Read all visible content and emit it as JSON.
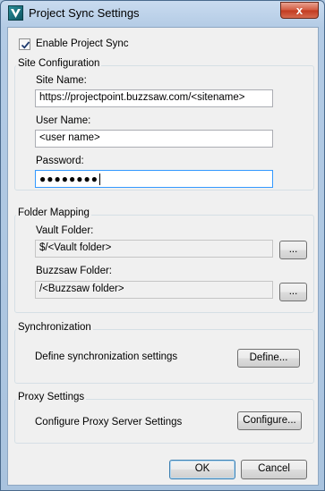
{
  "window": {
    "title": "Project Sync Settings",
    "close_glyph": "x"
  },
  "enable_sync": {
    "label": "Enable Project Sync",
    "checked": true
  },
  "site_config": {
    "title": "Site Configuration",
    "site_name_label": "Site Name:",
    "site_name_value": "https://projectpoint.buzzsaw.com/<sitename>",
    "user_name_label": "User Name:",
    "user_name_value": "<user name>",
    "password_label": "Password:",
    "password_mask": "●●●●●●●●"
  },
  "folder_mapping": {
    "title": "Folder Mapping",
    "vault_label": "Vault Folder:",
    "vault_value": "$/<Vault folder>",
    "buzzsaw_label": "Buzzsaw Folder:",
    "buzzsaw_value": "/<Buzzsaw folder>",
    "browse_label": "..."
  },
  "synchronization": {
    "title": "Synchronization",
    "description": "Define synchronization settings",
    "button_label": "Define..."
  },
  "proxy": {
    "title": "Proxy Settings",
    "description": "Configure Proxy Server Settings",
    "button_label": "Configure..."
  },
  "footer": {
    "ok_label": "OK",
    "cancel_label": "Cancel"
  },
  "colors": {
    "focus_border": "#3399ff",
    "default_button_border": "#3c7fb1",
    "close_button": "#c23a1f"
  }
}
